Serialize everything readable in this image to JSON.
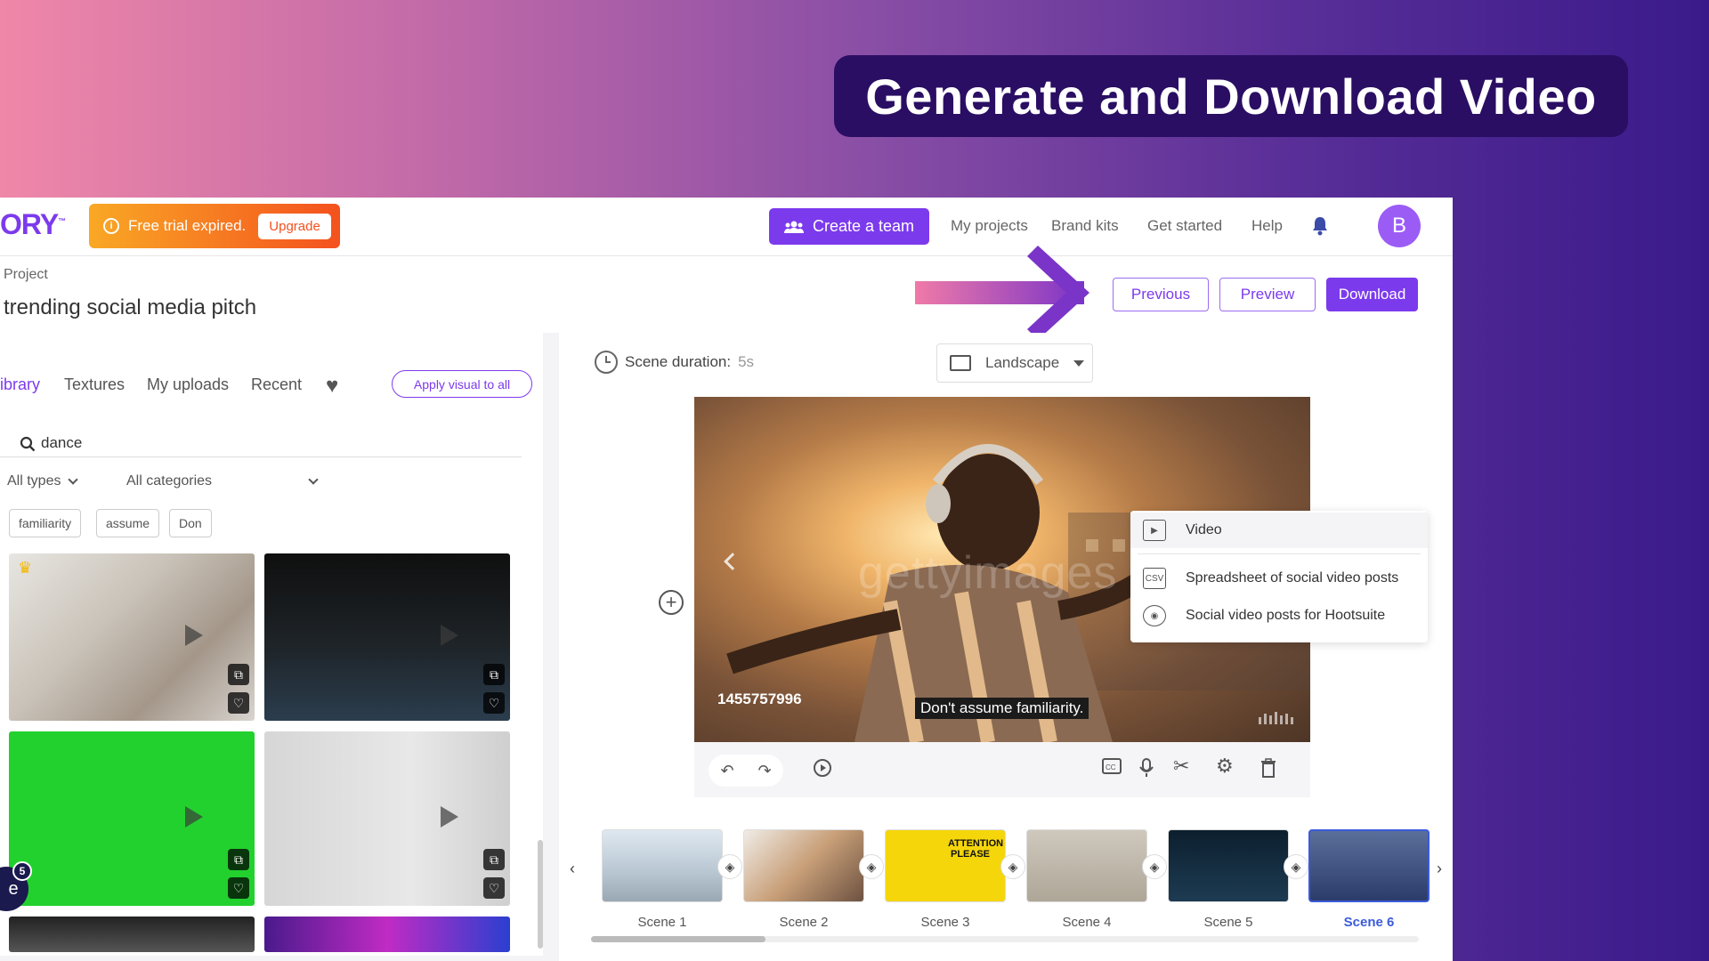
{
  "banner": {
    "title": "Generate and Download Video"
  },
  "topnav": {
    "logo": "ORY",
    "trial_text": "Free trial expired.",
    "upgrade_label": "Upgrade",
    "create_team_label": "Create a team",
    "links": [
      "My projects",
      "Brand kits",
      "Get started",
      "Help"
    ],
    "avatar_letter": "B"
  },
  "project": {
    "label": "Project",
    "title": "trending social media pitch"
  },
  "actions": {
    "previous": "Previous",
    "preview": "Preview",
    "download": "Download"
  },
  "download_menu": {
    "items": [
      {
        "label": "Video",
        "icon": "video-icon"
      },
      {
        "label": "Spreadsheet of social video posts",
        "icon": "csv-icon"
      },
      {
        "label": "Social video posts for Hootsuite",
        "icon": "owl-icon"
      }
    ]
  },
  "library": {
    "tabs": [
      "ibrary",
      "Textures",
      "My uploads",
      "Recent"
    ],
    "active_tab": "ibrary",
    "apply_label": "Apply visual to all",
    "search_value": "dance",
    "filter_types": "All types",
    "filter_categories": "All categories",
    "chips": [
      "familiarity",
      "assume",
      "Don"
    ],
    "badge_letter": "e",
    "badge_count": "5"
  },
  "editor": {
    "duration_label": "Scene duration:",
    "duration_value": "5s",
    "orientation": "Landscape",
    "preview_id": "1455757996",
    "caption": "Don't assume familiarity.",
    "watermark": "gettyimages"
  },
  "scenes": {
    "items": [
      "Scene 1",
      "Scene 2",
      "Scene 3",
      "Scene 4",
      "Scene 5",
      "Scene 6"
    ],
    "active_index": 5,
    "scene3_text": "ATTENTION PLEASE"
  },
  "colors": {
    "accent": "#7c3aed",
    "banner_bg": "#2a0e63",
    "active_scene": "#3b5bdb"
  }
}
